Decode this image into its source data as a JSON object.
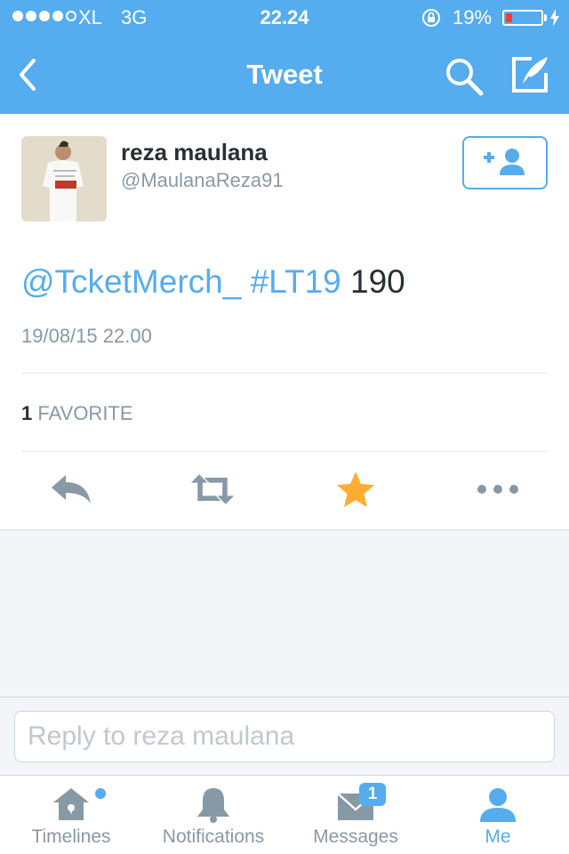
{
  "status_bar": {
    "carrier": "XL",
    "network": "3G",
    "time": "22.24",
    "battery_percent": "19%",
    "battery_level": 0.19,
    "signal_bars_filled": 4,
    "signal_bars_total": 5
  },
  "nav": {
    "title": "Tweet",
    "icons": [
      "back-chevron-icon",
      "search-icon",
      "compose-tweet-icon"
    ]
  },
  "tweet": {
    "author_name": "reza maulana",
    "author_handle": "@MaulanaReza91",
    "mention": "@TcketMerch_",
    "hashtag": "#LT19",
    "body_rest": "190",
    "timestamp": "19/08/15 22.00",
    "favorites_count": "1",
    "favorites_label": "FAVORITE",
    "icons": [
      "follow-user-icon",
      "reply-icon",
      "retweet-icon",
      "favorite-star-icon",
      "more-icon"
    ]
  },
  "reply": {
    "placeholder": "Reply to reza maulana",
    "value": ""
  },
  "tabbar": {
    "tabs": [
      {
        "label": "Timelines",
        "icon": "home-icon",
        "active": false
      },
      {
        "label": "Notifications",
        "icon": "bell-icon",
        "active": false
      },
      {
        "label": "Messages",
        "icon": "envelope-icon",
        "active": false,
        "badge": "1"
      },
      {
        "label": "Me",
        "icon": "profile-icon",
        "active": true
      }
    ]
  },
  "colors": {
    "brand_blue": "#55acee",
    "favorite_orange": "#ffac33",
    "battery_low_red": "#ff3b30",
    "text_dark": "#292f33",
    "text_muted": "#8899a6"
  }
}
